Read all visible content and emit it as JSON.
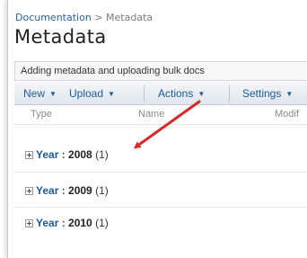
{
  "breadcrumb": {
    "parent": "Documentation",
    "separator": ">",
    "current": "Metadata"
  },
  "page_title": "Metadata",
  "description": "Adding metadata and uploading bulk docs",
  "toolbar": {
    "new_label": "New",
    "upload_label": "Upload",
    "actions_label": "Actions",
    "settings_label": "Settings"
  },
  "columns": {
    "type": "Type",
    "name": "Name",
    "modified": "Modif"
  },
  "groups": [
    {
      "field": "Year",
      "value": "2008",
      "count": "(1)"
    },
    {
      "field": "Year",
      "value": "2009",
      "count": "(1)"
    },
    {
      "field": "Year",
      "value": "2010",
      "count": "(1)"
    }
  ],
  "colors": {
    "link": "#1d5a9b",
    "arrow": "#d42a2a",
    "toolbar_top": "#f4f6f9",
    "toolbar_bottom": "#dfe6ee"
  },
  "icons": {
    "dropdown": "chevron-down-icon",
    "expand": "plus-box-icon",
    "annotation": "red-arrow-icon"
  }
}
